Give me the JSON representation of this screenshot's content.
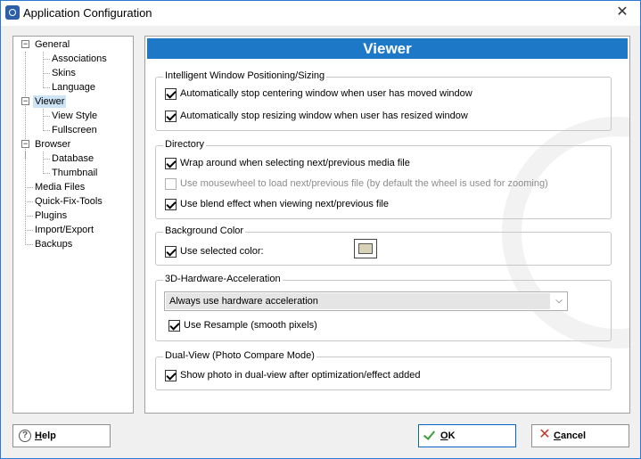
{
  "window": {
    "title": "Application Configuration",
    "close_glyph": "✕"
  },
  "tree": {
    "items": [
      {
        "label": "General",
        "expander": "−"
      },
      {
        "label": "Associations"
      },
      {
        "label": "Skins"
      },
      {
        "label": "Language"
      },
      {
        "label": "Viewer",
        "expander": "−",
        "selected": true
      },
      {
        "label": "View Style"
      },
      {
        "label": "Fullscreen"
      },
      {
        "label": "Browser",
        "expander": "−"
      },
      {
        "label": "Database"
      },
      {
        "label": "Thumbnail"
      },
      {
        "label": "Media Files"
      },
      {
        "label": "Quick-Fix-Tools"
      },
      {
        "label": "Plugins"
      },
      {
        "label": "Import/Export"
      },
      {
        "label": "Backups"
      }
    ]
  },
  "panel": {
    "title": "Viewer",
    "groups": {
      "positioning": {
        "label": "Intelligent Window Positioning/Sizing",
        "options": [
          {
            "label": "Automatically stop centering window when user has moved window",
            "checked": true
          },
          {
            "label": "Automatically stop resizing window when user has resized window",
            "checked": true
          }
        ]
      },
      "directory": {
        "label": "Directory",
        "options": [
          {
            "label": "Wrap around when selecting next/previous media file",
            "checked": true
          },
          {
            "label": "Use mousewheel to load next/previous file (by default the wheel is used for zooming)",
            "checked": false,
            "disabled": true
          },
          {
            "label": "Use blend effect when viewing next/previous file",
            "checked": true
          }
        ]
      },
      "background": {
        "label": "Background Color",
        "option": {
          "label": "Use selected color:",
          "checked": true
        },
        "color": "#d8d3b8"
      },
      "hardware": {
        "label": "3D-Hardware-Acceleration",
        "select_value": "Always use hardware acceleration",
        "select_arrow": "⌵",
        "option": {
          "label": "Use Resample (smooth pixels)",
          "checked": true
        }
      },
      "dualview": {
        "label": "Dual-View (Photo Compare Mode)",
        "option": {
          "label": "Show photo in dual-view after optimization/effect added",
          "checked": true
        }
      }
    }
  },
  "buttons": {
    "help_key": "H",
    "help_rest": "elp",
    "help_icon": "?",
    "ok_key": "O",
    "ok_rest": "K",
    "cancel_key": "C",
    "cancel_rest": "ancel",
    "cancel_icon": "✕"
  },
  "colors": {
    "header_blue": "#1e78c8",
    "selection": "#cde4f7",
    "ok_green": "#3aa03a",
    "cancel_red": "#c0392b"
  }
}
